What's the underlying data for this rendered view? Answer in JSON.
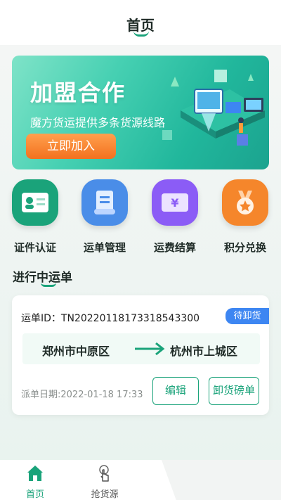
{
  "header": {
    "title": "首页"
  },
  "banner": {
    "title": "加盟合作",
    "subtitle": "魔方货运提供多条货源线路",
    "button": "立即加入"
  },
  "shortcuts": [
    {
      "label": "证件认证",
      "icon": "id-card-icon",
      "color": "#1aa37a"
    },
    {
      "label": "运单管理",
      "icon": "waybill-scroll-icon",
      "color": "#4a8de8"
    },
    {
      "label": "运费结算",
      "icon": "yuan-ticket-icon",
      "color": "#8b5cf6"
    },
    {
      "label": "积分兑换",
      "icon": "medal-icon",
      "color": "#f5862b"
    }
  ],
  "section": {
    "title": "进行中运单"
  },
  "order": {
    "id_label": "运单ID：",
    "id": "TN20220118173318543300",
    "status": "待卸货",
    "from": "郑州市中原区",
    "to": "杭州市上城区",
    "date": "派单日期:2022-01-18 17:33",
    "edit_button": "编辑",
    "unload_button": "卸货磅单"
  },
  "tabbar": {
    "items": [
      {
        "label": "首页",
        "icon": "home-icon",
        "active": true
      },
      {
        "label": "抢货源",
        "icon": "tap-hand-icon",
        "active": false
      }
    ]
  },
  "colors": {
    "accent": "#1aa37a",
    "status": "#3d86f2",
    "banner_button": "#f3711f"
  }
}
